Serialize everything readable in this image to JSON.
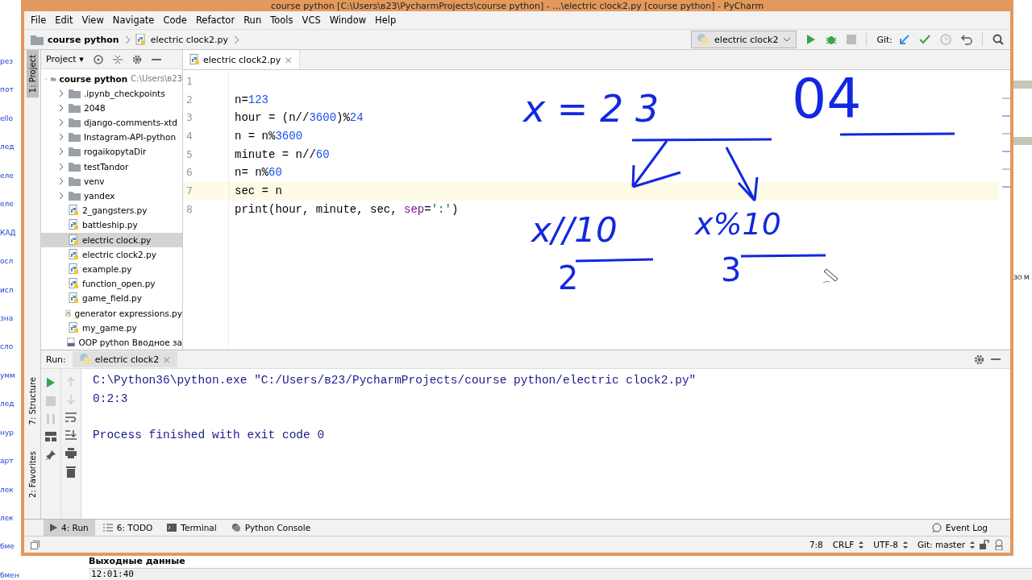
{
  "window": {
    "title": "course python [C:\\Users\\в23\\PycharmProjects\\course python] - ...\\electric clock2.py [course python] - PyCharm"
  },
  "menu": [
    "File",
    "Edit",
    "View",
    "Navigate",
    "Code",
    "Refactor",
    "Run",
    "Tools",
    "VCS",
    "Window",
    "Help"
  ],
  "breadcrumbs": [
    "course python",
    "electric clock2.py"
  ],
  "toolbar": {
    "run_config": "electric clock2",
    "git_label": "Git:"
  },
  "left_stripe": [
    "1: Project",
    "7: Structure",
    "2: Favorites"
  ],
  "project": {
    "label": "Project",
    "dropdown_caret": "▾",
    "root": {
      "name": "course python",
      "path": "C:\\Users\\в23",
      "expanded": true,
      "children": [
        {
          "kind": "folder",
          "name": ".ipynb_checkpoints",
          "expanded": false,
          "selected": false
        },
        {
          "kind": "folder",
          "name": "2048",
          "expanded": false,
          "selected": false
        },
        {
          "kind": "folder",
          "name": "django-comments-xtd",
          "expanded": false,
          "selected": false
        },
        {
          "kind": "folder",
          "name": "Instagram-API-python",
          "expanded": false,
          "selected": false
        },
        {
          "kind": "folder",
          "name": "rogaikopytaDir",
          "expanded": false,
          "selected": false
        },
        {
          "kind": "folder",
          "name": "testTandor",
          "expanded": false,
          "selected": false
        },
        {
          "kind": "folder",
          "name": "venv",
          "expanded": false,
          "selected": false
        },
        {
          "kind": "folder",
          "name": "yandex",
          "expanded": false,
          "selected": false
        },
        {
          "kind": "py",
          "name": "2_gangsters.py",
          "selected": false
        },
        {
          "kind": "py",
          "name": "battleship.py",
          "selected": false
        },
        {
          "kind": "py",
          "name": "electric clock.py",
          "selected": true
        },
        {
          "kind": "py",
          "name": "electric clock2.py",
          "selected": false
        },
        {
          "kind": "py",
          "name": "example.py",
          "selected": false
        },
        {
          "kind": "py",
          "name": "function_open.py",
          "selected": false
        },
        {
          "kind": "py",
          "name": "game_field.py",
          "selected": false
        },
        {
          "kind": "py",
          "name": "generator expressions.py",
          "selected": false
        },
        {
          "kind": "py",
          "name": "my_game.py",
          "selected": false
        },
        {
          "kind": "ipynb",
          "name": "OOP python Вводное за",
          "selected": false
        }
      ]
    }
  },
  "editor": {
    "tab": "electric clock2.py",
    "tab_close": "×",
    "lines": [
      {
        "number": "1",
        "current": false
      },
      {
        "number": "2",
        "current": false,
        "tokens": [
          {
            "kind": "plain",
            "text": "n="
          },
          {
            "kind": "num",
            "text": "123"
          }
        ]
      },
      {
        "number": "3",
        "current": false,
        "tokens": [
          {
            "kind": "plain",
            "text": "hour = (n//"
          },
          {
            "kind": "num",
            "text": "3600"
          },
          {
            "kind": "plain",
            "text": ")%"
          },
          {
            "kind": "num",
            "text": "24"
          }
        ]
      },
      {
        "number": "4",
        "current": false,
        "tokens": [
          {
            "kind": "plain",
            "text": "n = n%"
          },
          {
            "kind": "num",
            "text": "3600"
          }
        ]
      },
      {
        "number": "5",
        "current": false,
        "tokens": [
          {
            "kind": "plain",
            "text": "minute = n//"
          },
          {
            "kind": "num",
            "text": "60"
          }
        ]
      },
      {
        "number": "6",
        "current": false,
        "tokens": [
          {
            "kind": "plain",
            "text": "n= n%"
          },
          {
            "kind": "num",
            "text": "60"
          }
        ]
      },
      {
        "number": "7",
        "current": true,
        "tokens": [
          {
            "kind": "plain",
            "text": "sec = n"
          }
        ]
      },
      {
        "number": "8",
        "current": false,
        "tokens": [
          {
            "kind": "plain",
            "text": "print(hour, minute, sec, "
          },
          {
            "kind": "param",
            "text": "sep"
          },
          {
            "kind": "plain",
            "text": "="
          },
          {
            "kind": "str",
            "text": "':'"
          },
          {
            "kind": "plain",
            "text": ")"
          }
        ]
      }
    ],
    "annotations": [
      "x = 2 3",
      "04",
      "x//10",
      "2",
      "x%10",
      "3"
    ]
  },
  "run": {
    "label": "Run:",
    "tab": "electric clock2",
    "tab_close": "×",
    "output": [
      {
        "kind": "stdout",
        "text": "C:\\Python36\\python.exe \"C:/Users/в23/PycharmProjects/course python/electric clock2.py\""
      },
      {
        "kind": "stdout",
        "text": "0:2:3"
      },
      {
        "kind": "exit",
        "text": "Process finished with exit code 0"
      }
    ]
  },
  "tool_windows": [
    {
      "label": "4: Run",
      "selected": true
    },
    {
      "label": "6: TODO",
      "selected": false
    },
    {
      "label": "Terminal",
      "selected": false
    },
    {
      "label": "Python Console",
      "selected": false
    }
  ],
  "event_log": "Event Log",
  "status_bar": [
    "7:8",
    "CRLF",
    "UTF-8",
    "Git: master"
  ],
  "background": {
    "left_fragments": [
      "рез",
      "пот",
      "ello",
      "лед",
      "еле",
      "еле",
      "КАД",
      "осл",
      "исл",
      "зна",
      "сло",
      "умм",
      "лед",
      "нур",
      "арт",
      "лек",
      "лек",
      "бме",
      "бмен"
    ],
    "right_fragment": "ЗО М",
    "heading": "Выходные данные",
    "value": "12:01:40"
  }
}
